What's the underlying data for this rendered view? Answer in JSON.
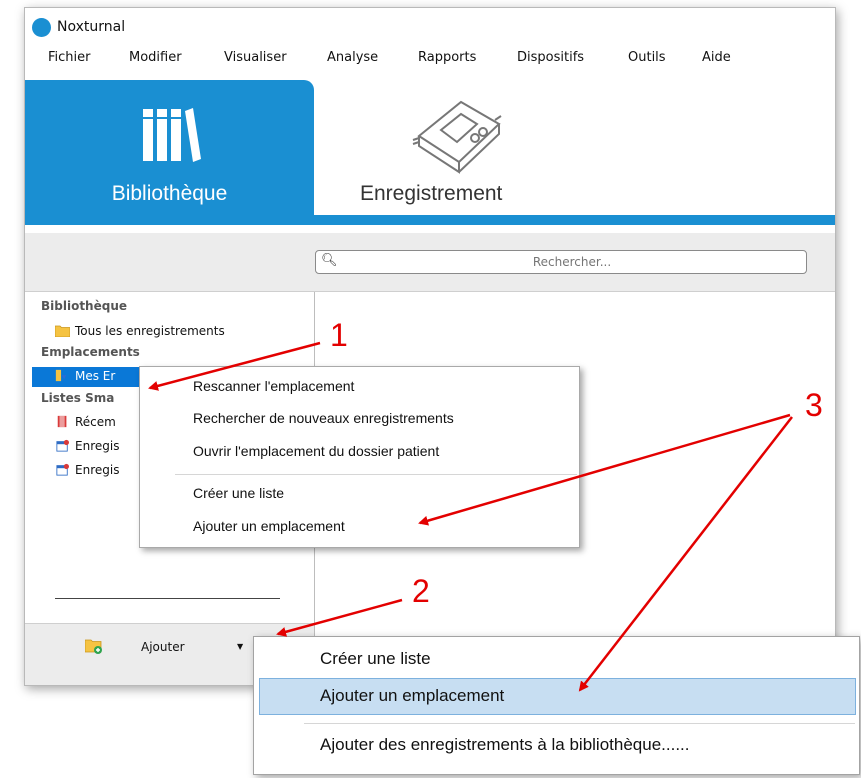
{
  "window": {
    "title": "Noxturnal"
  },
  "menu": [
    "Fichier",
    "Modifier",
    "Visualiser",
    "Analyse",
    "Rapports",
    "Dispositifs",
    "Outils",
    "Aide"
  ],
  "nav": {
    "library_label": "Bibliothèque",
    "recording_label": "Enregistrement",
    "active_color": "#1a8fd2"
  },
  "search": {
    "placeholder": "Rechercher..."
  },
  "sidebar": {
    "library_header": "Bibliothèque",
    "all_recordings": "Tous les enregistrements",
    "locations_header": "Emplacements",
    "my_location": "Mes Er",
    "smart_lists_header": "Listes Sma",
    "smart_items": [
      "Récem",
      "Enregis",
      "Enregis"
    ],
    "add_button": "Ajouter"
  },
  "context_menu": {
    "items": [
      "Rescanner l'emplacement",
      "Rechercher de nouveaux enregistrements",
      "Ouvrir l'emplacement du dossier patient",
      "Créer une liste",
      "Ajouter un emplacement"
    ]
  },
  "add_dropdown": {
    "items": [
      "Créer une liste",
      "Ajouter un emplacement",
      "Ajouter des enregistrements à la bibliothèque......"
    ],
    "highlighted": "Ajouter un emplacement"
  },
  "annotations": {
    "labels": [
      "1",
      "2",
      "3"
    ],
    "color": "#e30000"
  }
}
